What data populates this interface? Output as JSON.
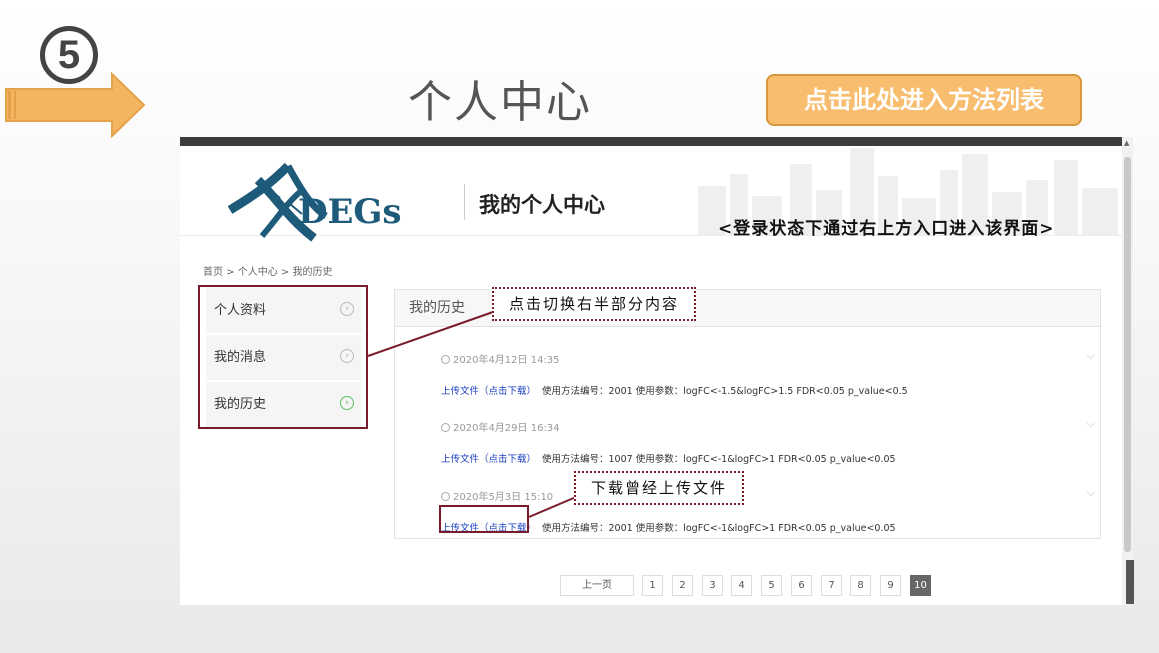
{
  "slide": {
    "step_number": "5",
    "title": "个人中心",
    "method_button": "点击此处进入方法列表"
  },
  "site": {
    "logo_text": "DEGs",
    "header_title": "我的个人中心",
    "login_note": "<登录状态下通过右上方入口进入该界面>"
  },
  "breadcrumb": [
    "首页",
    "个人中心",
    "我的历史"
  ],
  "breadcrumb_sep": " > ",
  "side_menu": [
    {
      "label": "个人资料",
      "active": false
    },
    {
      "label": "我的消息",
      "active": false
    },
    {
      "label": "我的历史",
      "active": true
    }
  ],
  "history": {
    "title": "我的历史",
    "records": [
      {
        "time": "2020年4月12日 14:35",
        "link": "上传文件（点击下载）",
        "detail": "使用方法编号：2001 使用参数：logFC<-1.5&logFC>1.5 FDR<0.05 p_value<0.5"
      },
      {
        "time": "2020年4月29日 16:34",
        "link": "上传文件（点击下载）",
        "detail": "使用方法编号：1007 使用参数：logFC<-1&logFC>1 FDR<0.05 p_value<0.05"
      },
      {
        "time": "2020年5月3日 15:10",
        "link": "上传文件（点击下载）",
        "detail": "使用方法编号：2001 使用参数：logFC<-1&logFC>1 FDR<0.05 p_value<0.05"
      }
    ]
  },
  "pagination": {
    "prev": "上一页",
    "pages": [
      "1",
      "2",
      "3",
      "4",
      "5",
      "6",
      "7",
      "8",
      "9",
      "10"
    ],
    "current": "10"
  },
  "annotations": {
    "switch_note": "点击切换右半部分内容",
    "download_note": "下载曾经上传文件"
  },
  "colors": {
    "accent_orange": "#f8bd6f",
    "annotation_red": "#7a1b2a",
    "link_blue": "#1a3fc1",
    "logo_blue": "#1e5a7a"
  }
}
